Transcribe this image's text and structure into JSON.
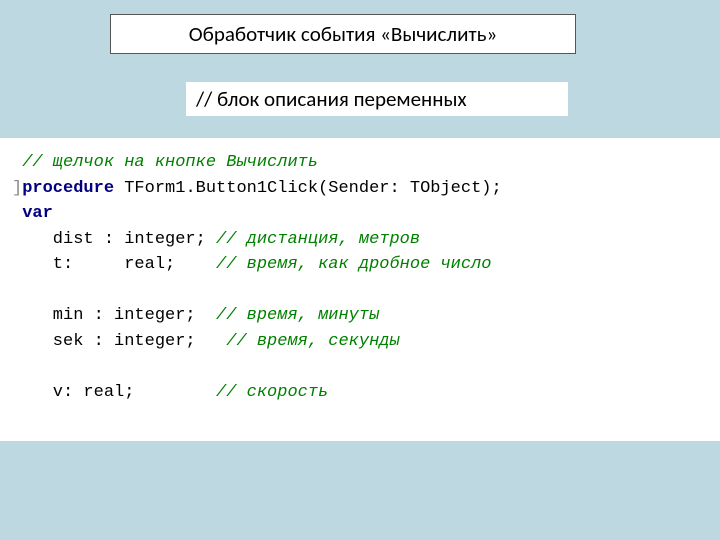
{
  "title": "Обработчик события «Вычислить»",
  "subtitle": "// блок описания переменных",
  "code": {
    "c1": "// щелчок на кнопке Вычислить",
    "gut": "]",
    "kw_proc": "procedure",
    "proc_sig": " TForm1.Button1Click(Sender: TObject);",
    "kw_var": "var",
    "l_dist": "    dist : integer; ",
    "c_dist": "// дистанция, метров",
    "l_t": "    t:     real;    ",
    "c_t": "// время, как дробное число",
    "l_min": "    min : integer;  ",
    "c_min": "// время, минуты",
    "l_sek": "    sek : integer;   ",
    "c_sek": "// время, секунды",
    "l_v": "    v: real;        ",
    "c_v": "// скорость"
  }
}
